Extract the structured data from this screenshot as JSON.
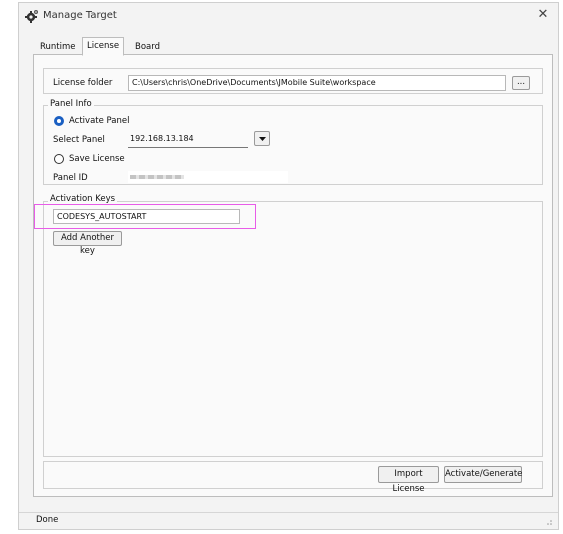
{
  "window": {
    "title": "Manage Target",
    "close_glyph": "✕"
  },
  "tabs": [
    {
      "label": "Runtime",
      "active": false
    },
    {
      "label": "License",
      "active": true
    },
    {
      "label": "Board",
      "active": false
    }
  ],
  "license_folder": {
    "label": "License folder",
    "value": "C:\\Users\\chris\\OneDrive\\Documents\\JMobile Suite\\workspace",
    "browse_label": "..."
  },
  "panel_info": {
    "legend": "Panel Info",
    "activate_label": "Activate Panel",
    "activate_selected": true,
    "select_panel_label": "Select Panel",
    "select_panel_value": "192.168.13.184",
    "save_license_label": "Save License",
    "save_license_selected": false,
    "panel_id_label": "Panel ID"
  },
  "activation_keys": {
    "legend": "Activation Keys",
    "key_value": "CODESYS_AUTOSTART",
    "add_key_label": "Add Another key",
    "highlight_color": "#e85ce8"
  },
  "actions": {
    "import_label": "Import License",
    "activate_label": "Activate/Generate"
  },
  "status": {
    "text": "Done"
  },
  "colors": {
    "accent": "#1a5fc2"
  }
}
